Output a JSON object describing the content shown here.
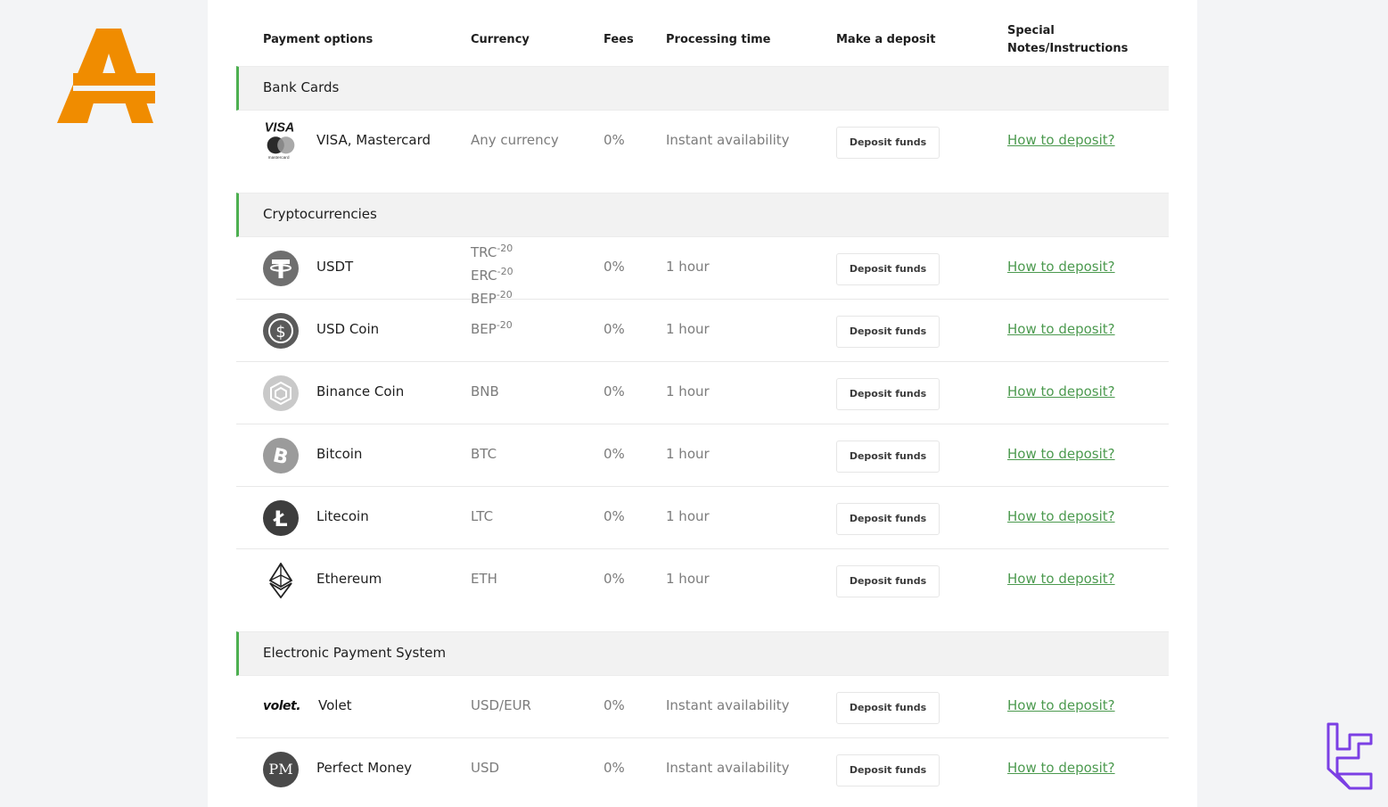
{
  "brand": {
    "accent": "#f08c00",
    "section_accent": "#4caf50",
    "link_color": "#4c9a4f",
    "corner_logo_color": "#7b3fe4"
  },
  "table": {
    "headers": {
      "payment_options": "Payment options",
      "currency": "Currency",
      "fees": "Fees",
      "processing_time": "Processing time",
      "make_deposit": "Make a deposit",
      "notes_line1": "Special",
      "notes_line2": "Notes/Instructions"
    },
    "sections": [
      {
        "title": "Bank Cards",
        "rows": [
          {
            "icon": "visa-mastercard-icon",
            "name": "VISA, Mastercard",
            "currency": "Any currency",
            "fee": "0%",
            "processing": "Instant availability",
            "button": "Deposit funds",
            "link": "How to deposit?"
          }
        ]
      },
      {
        "title": "Cryptocurrencies",
        "rows": [
          {
            "icon": "tether-icon",
            "name": "USDT",
            "currency_lines": [
              {
                "base": "TRC",
                "sup": "-20"
              },
              {
                "base": "ERC",
                "sup": "-20"
              },
              {
                "base": "BEP",
                "sup": "-20"
              }
            ],
            "fee": "0%",
            "processing": "1 hour",
            "button": "Deposit funds",
            "link": "How to deposit?"
          },
          {
            "icon": "usd-coin-icon",
            "name": "USD Coin",
            "currency_base": "BEP",
            "currency_sup": "-20",
            "fee": "0%",
            "processing": "1 hour",
            "button": "Deposit funds",
            "link": "How to deposit?"
          },
          {
            "icon": "binance-coin-icon",
            "name": "Binance Coin",
            "currency": "BNB",
            "fee": "0%",
            "processing": "1 hour",
            "button": "Deposit funds",
            "link": "How to deposit?"
          },
          {
            "icon": "bitcoin-icon",
            "name": "Bitcoin",
            "currency": "BTC",
            "fee": "0%",
            "processing": "1 hour",
            "button": "Deposit funds",
            "link": "How to deposit?"
          },
          {
            "icon": "litecoin-icon",
            "name": "Litecoin",
            "currency": "LTC",
            "fee": "0%",
            "processing": "1 hour",
            "button": "Deposit funds",
            "link": "How to deposit?"
          },
          {
            "icon": "ethereum-icon",
            "name": "Ethereum",
            "currency": "ETH",
            "fee": "0%",
            "processing": "1 hour",
            "button": "Deposit funds",
            "link": "How to deposit?"
          }
        ]
      },
      {
        "title": "Electronic Payment System",
        "rows": [
          {
            "icon": "volet-logo",
            "logo_text": "volet.",
            "name": "Volet",
            "currency": "USD/EUR",
            "fee": "0%",
            "processing": "Instant availability",
            "button": "Deposit funds",
            "link": "How to deposit?"
          },
          {
            "icon": "perfect-money-icon",
            "logo_text": "PM",
            "name": "Perfect Money",
            "currency": "USD",
            "fee": "0%",
            "processing": "Instant availability",
            "button": "Deposit funds",
            "link": "How to deposit?"
          }
        ]
      }
    ]
  }
}
